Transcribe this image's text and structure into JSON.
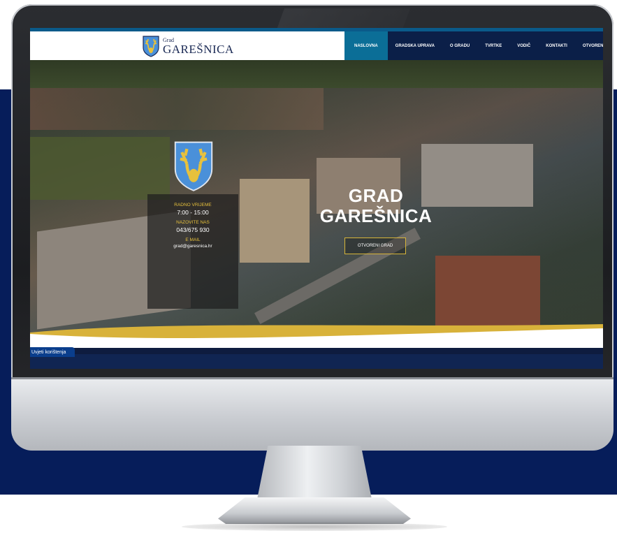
{
  "site": {
    "logo": {
      "small": "Grad",
      "name": "GAREŠNICA"
    },
    "nav": [
      {
        "label": "NASLOVNA",
        "active": true
      },
      {
        "label": "GRADSKA UPRAVA"
      },
      {
        "label": "O GRADU"
      },
      {
        "label": "TVRTKE"
      },
      {
        "label": "VODIČ"
      },
      {
        "label": "KONTAKTI"
      },
      {
        "label": "OTVORENI GRA"
      }
    ],
    "hero": {
      "title_line1": "GRAD",
      "title_line2": "GAREŠNICA",
      "button": "OTVORENI GRAD"
    },
    "info": {
      "hours_label": "RADNO VRIJEME",
      "hours_value": "7:00 - 15:00",
      "phone_label": "NAZOVITE NAS",
      "phone_value": "043/675 930",
      "email_label": "E MAIL",
      "email_value": "grad@garesnica.hr"
    },
    "cookie": "Uvjeti korištenja"
  },
  "colors": {
    "navy": "#061d5a",
    "accent_blue": "#0b6e97",
    "gold": "#e7c13c",
    "crest_blue": "#4a90d9"
  },
  "icons": [
    "coat-of-arms-icon"
  ]
}
